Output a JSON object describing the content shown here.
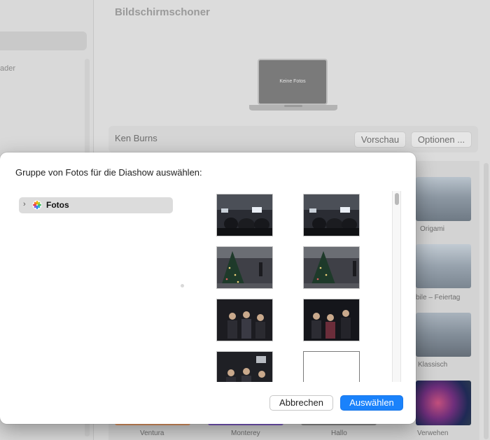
{
  "sidebar": {
    "partial_label": "ader"
  },
  "main": {
    "title": "Bildschirmschoner",
    "preview_text": "Keine Fotos",
    "style_name": "Ken Burns",
    "preview_button": "Vorschau",
    "options_button": "Optionen ...",
    "gallery": [
      {
        "label": "Origami"
      },
      {
        "label": "bile – Feiertag"
      },
      {
        "label": "Klassisch"
      },
      {
        "label": "Ventura"
      },
      {
        "label": "Monterey"
      },
      {
        "label": "Hallo"
      },
      {
        "label": "Verwehen"
      }
    ]
  },
  "dialog": {
    "title": "Gruppe von Fotos für die Diashow auswählen:",
    "tree": {
      "item_label": "Fotos",
      "icon": "photos-app-icon"
    },
    "cancel_label": "Abbrechen",
    "confirm_label": "Auswählen"
  },
  "colors": {
    "accent": "#1a82fb"
  }
}
